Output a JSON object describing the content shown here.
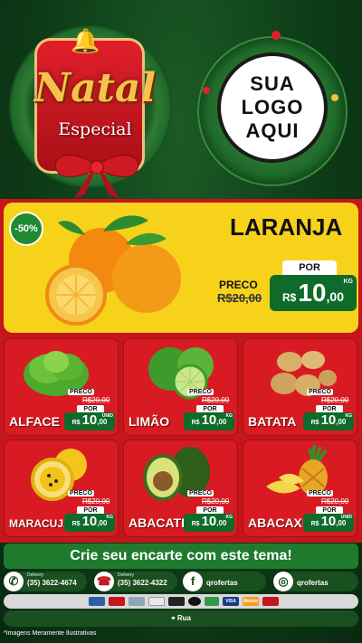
{
  "header": {
    "title_main": "Natal",
    "title_sub": "Especial",
    "logo_lines": [
      "SUA",
      "LOGO",
      "AQUI"
    ]
  },
  "hero": {
    "discount": "-50%",
    "name": "LARANJA",
    "preco_label": "PRECO",
    "old_price": "R$20,00",
    "por_label": "POR",
    "currency": "R$",
    "price_int": "10",
    "price_cents": ",00",
    "unit": "KG"
  },
  "products": [
    {
      "name": "ALFACE",
      "preco_label": "PRECO",
      "old_price": "R$20,00",
      "por_label": "POR",
      "currency": "R$",
      "price_int": "10",
      "price_cents": ",00",
      "unit": "UNID"
    },
    {
      "name": "LIMÃO",
      "preco_label": "PRECO",
      "old_price": "R$20,00",
      "por_label": "POR",
      "currency": "R$",
      "price_int": "10",
      "price_cents": ",00",
      "unit": "KG"
    },
    {
      "name": "BATATA",
      "preco_label": "PRECO",
      "old_price": "R$20,00",
      "por_label": "POR",
      "currency": "R$",
      "price_int": "10",
      "price_cents": ",00",
      "unit": "KG"
    },
    {
      "name": "MARACUJÁ",
      "preco_label": "PRECO",
      "old_price": "R$20,00",
      "por_label": "POR",
      "currency": "R$",
      "price_int": "10",
      "price_cents": ",00",
      "unit": "KG"
    },
    {
      "name": "ABACATE",
      "preco_label": "PRECO",
      "old_price": "R$20,00",
      "por_label": "POR",
      "currency": "R$",
      "price_int": "10",
      "price_cents": ",00",
      "unit": "KG"
    },
    {
      "name": "ABACAXI",
      "preco_label": "PRECO",
      "old_price": "R$20,00",
      "por_label": "POR",
      "currency": "R$",
      "price_int": "10",
      "price_cents": ",00",
      "unit": "UNID"
    }
  ],
  "banner": "Crie seu encarte com este tema!",
  "contacts": [
    {
      "icon": "whatsapp-icon",
      "small": "Delivery",
      "text": "(35) 3622-4674"
    },
    {
      "icon": "phone-icon",
      "small": "Delivery",
      "text": "(35) 3622-4322"
    },
    {
      "icon": "facebook-icon",
      "small": "",
      "text": "qrofertas"
    },
    {
      "icon": "instagram-icon",
      "small": "",
      "text": "qrofertas"
    }
  ],
  "payments": [
    "VISA",
    "Master"
  ],
  "address": "Rua",
  "disclaimer": "*Imagens Meramente Ilustrativas",
  "colors": {
    "green_bg": "#0d3b17",
    "red_panel": "#c4161c",
    "yellow_hero": "#f7d21b",
    "price_green": "#0f6b2a"
  }
}
